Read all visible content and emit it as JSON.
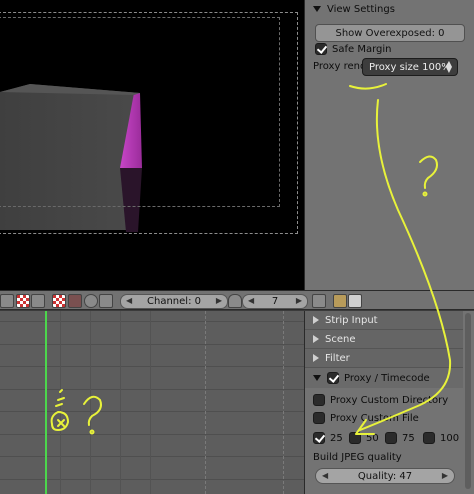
{
  "view_settings": {
    "title": "View Settings",
    "show_overexposed": "Show Overexposed: 0",
    "safe_margin": "Safe Margin",
    "proxy_render_label": "Proxy rend",
    "proxy_size": "Proxy size 100%"
  },
  "header": {
    "channel": "Channel: 0",
    "frame": "7"
  },
  "panels": {
    "strip_input": "Strip Input",
    "scene": "Scene",
    "filter": "Filter",
    "proxy_timecode": "Proxy / Timecode",
    "proxy_custom_directory": "Proxy Custom Directory",
    "proxy_custom_file": "Proxy Custom File",
    "sizes": [
      "25",
      "50",
      "75",
      "100"
    ],
    "build_jpeg_quality": "Build JPEG quality",
    "quality": "Quality: 47"
  },
  "colors": {
    "accent_annotation": "#e8f23a",
    "playhead": "#4cd64c",
    "magenta_face": "#d84fd8"
  }
}
